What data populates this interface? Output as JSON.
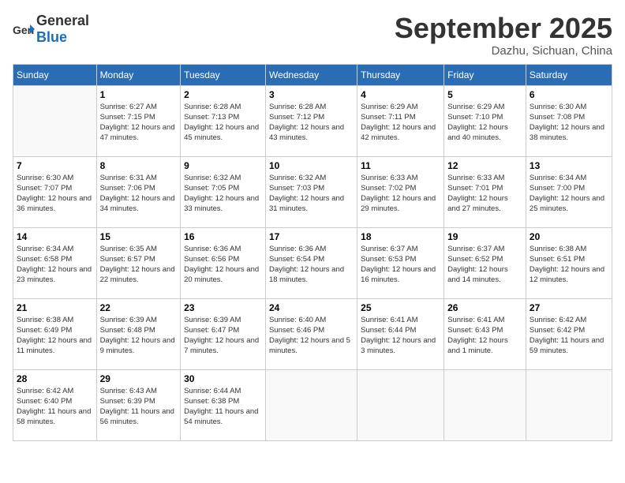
{
  "logo": {
    "general": "General",
    "blue": "Blue"
  },
  "title": "September 2025",
  "subtitle": "Dazhu, Sichuan, China",
  "days_of_week": [
    "Sunday",
    "Monday",
    "Tuesday",
    "Wednesday",
    "Thursday",
    "Friday",
    "Saturday"
  ],
  "weeks": [
    [
      {
        "day": "",
        "info": ""
      },
      {
        "day": "1",
        "info": "Sunrise: 6:27 AM\nSunset: 7:15 PM\nDaylight: 12 hours and 47 minutes."
      },
      {
        "day": "2",
        "info": "Sunrise: 6:28 AM\nSunset: 7:13 PM\nDaylight: 12 hours and 45 minutes."
      },
      {
        "day": "3",
        "info": "Sunrise: 6:28 AM\nSunset: 7:12 PM\nDaylight: 12 hours and 43 minutes."
      },
      {
        "day": "4",
        "info": "Sunrise: 6:29 AM\nSunset: 7:11 PM\nDaylight: 12 hours and 42 minutes."
      },
      {
        "day": "5",
        "info": "Sunrise: 6:29 AM\nSunset: 7:10 PM\nDaylight: 12 hours and 40 minutes."
      },
      {
        "day": "6",
        "info": "Sunrise: 6:30 AM\nSunset: 7:08 PM\nDaylight: 12 hours and 38 minutes."
      }
    ],
    [
      {
        "day": "7",
        "info": "Sunrise: 6:30 AM\nSunset: 7:07 PM\nDaylight: 12 hours and 36 minutes."
      },
      {
        "day": "8",
        "info": "Sunrise: 6:31 AM\nSunset: 7:06 PM\nDaylight: 12 hours and 34 minutes."
      },
      {
        "day": "9",
        "info": "Sunrise: 6:32 AM\nSunset: 7:05 PM\nDaylight: 12 hours and 33 minutes."
      },
      {
        "day": "10",
        "info": "Sunrise: 6:32 AM\nSunset: 7:03 PM\nDaylight: 12 hours and 31 minutes."
      },
      {
        "day": "11",
        "info": "Sunrise: 6:33 AM\nSunset: 7:02 PM\nDaylight: 12 hours and 29 minutes."
      },
      {
        "day": "12",
        "info": "Sunrise: 6:33 AM\nSunset: 7:01 PM\nDaylight: 12 hours and 27 minutes."
      },
      {
        "day": "13",
        "info": "Sunrise: 6:34 AM\nSunset: 7:00 PM\nDaylight: 12 hours and 25 minutes."
      }
    ],
    [
      {
        "day": "14",
        "info": "Sunrise: 6:34 AM\nSunset: 6:58 PM\nDaylight: 12 hours and 23 minutes."
      },
      {
        "day": "15",
        "info": "Sunrise: 6:35 AM\nSunset: 6:57 PM\nDaylight: 12 hours and 22 minutes."
      },
      {
        "day": "16",
        "info": "Sunrise: 6:36 AM\nSunset: 6:56 PM\nDaylight: 12 hours and 20 minutes."
      },
      {
        "day": "17",
        "info": "Sunrise: 6:36 AM\nSunset: 6:54 PM\nDaylight: 12 hours and 18 minutes."
      },
      {
        "day": "18",
        "info": "Sunrise: 6:37 AM\nSunset: 6:53 PM\nDaylight: 12 hours and 16 minutes."
      },
      {
        "day": "19",
        "info": "Sunrise: 6:37 AM\nSunset: 6:52 PM\nDaylight: 12 hours and 14 minutes."
      },
      {
        "day": "20",
        "info": "Sunrise: 6:38 AM\nSunset: 6:51 PM\nDaylight: 12 hours and 12 minutes."
      }
    ],
    [
      {
        "day": "21",
        "info": "Sunrise: 6:38 AM\nSunset: 6:49 PM\nDaylight: 12 hours and 11 minutes."
      },
      {
        "day": "22",
        "info": "Sunrise: 6:39 AM\nSunset: 6:48 PM\nDaylight: 12 hours and 9 minutes."
      },
      {
        "day": "23",
        "info": "Sunrise: 6:39 AM\nSunset: 6:47 PM\nDaylight: 12 hours and 7 minutes."
      },
      {
        "day": "24",
        "info": "Sunrise: 6:40 AM\nSunset: 6:46 PM\nDaylight: 12 hours and 5 minutes."
      },
      {
        "day": "25",
        "info": "Sunrise: 6:41 AM\nSunset: 6:44 PM\nDaylight: 12 hours and 3 minutes."
      },
      {
        "day": "26",
        "info": "Sunrise: 6:41 AM\nSunset: 6:43 PM\nDaylight: 12 hours and 1 minute."
      },
      {
        "day": "27",
        "info": "Sunrise: 6:42 AM\nSunset: 6:42 PM\nDaylight: 11 hours and 59 minutes."
      }
    ],
    [
      {
        "day": "28",
        "info": "Sunrise: 6:42 AM\nSunset: 6:40 PM\nDaylight: 11 hours and 58 minutes."
      },
      {
        "day": "29",
        "info": "Sunrise: 6:43 AM\nSunset: 6:39 PM\nDaylight: 11 hours and 56 minutes."
      },
      {
        "day": "30",
        "info": "Sunrise: 6:44 AM\nSunset: 6:38 PM\nDaylight: 11 hours and 54 minutes."
      },
      {
        "day": "",
        "info": ""
      },
      {
        "day": "",
        "info": ""
      },
      {
        "day": "",
        "info": ""
      },
      {
        "day": "",
        "info": ""
      }
    ]
  ]
}
